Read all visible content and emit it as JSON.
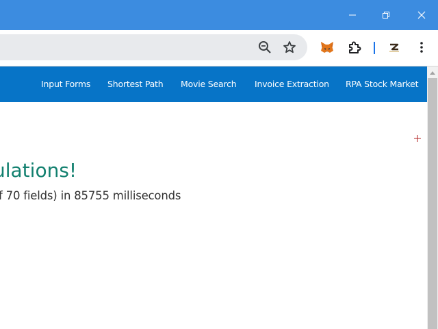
{
  "window_controls": {
    "minimize_icon": "minimize-icon",
    "maximize_icon": "restore-icon",
    "close_icon": "close-icon"
  },
  "toolbar": {
    "icons": [
      "zoom-out-icon",
      "star-icon",
      "fox-extension-icon",
      "puzzle-extensions-icon",
      "profile-z-icon",
      "kebab-menu-icon"
    ],
    "accent_color": "#1a73e8"
  },
  "nav": {
    "background": "#0774c7",
    "links": [
      "Input Forms",
      "Shortest Path",
      "Movie Search",
      "Invoice Extraction",
      "RPA Stock Market"
    ]
  },
  "content": {
    "heading": "ulations!",
    "result": "f 70 fields) in 85755 milliseconds",
    "heading_color": "#12806f"
  }
}
